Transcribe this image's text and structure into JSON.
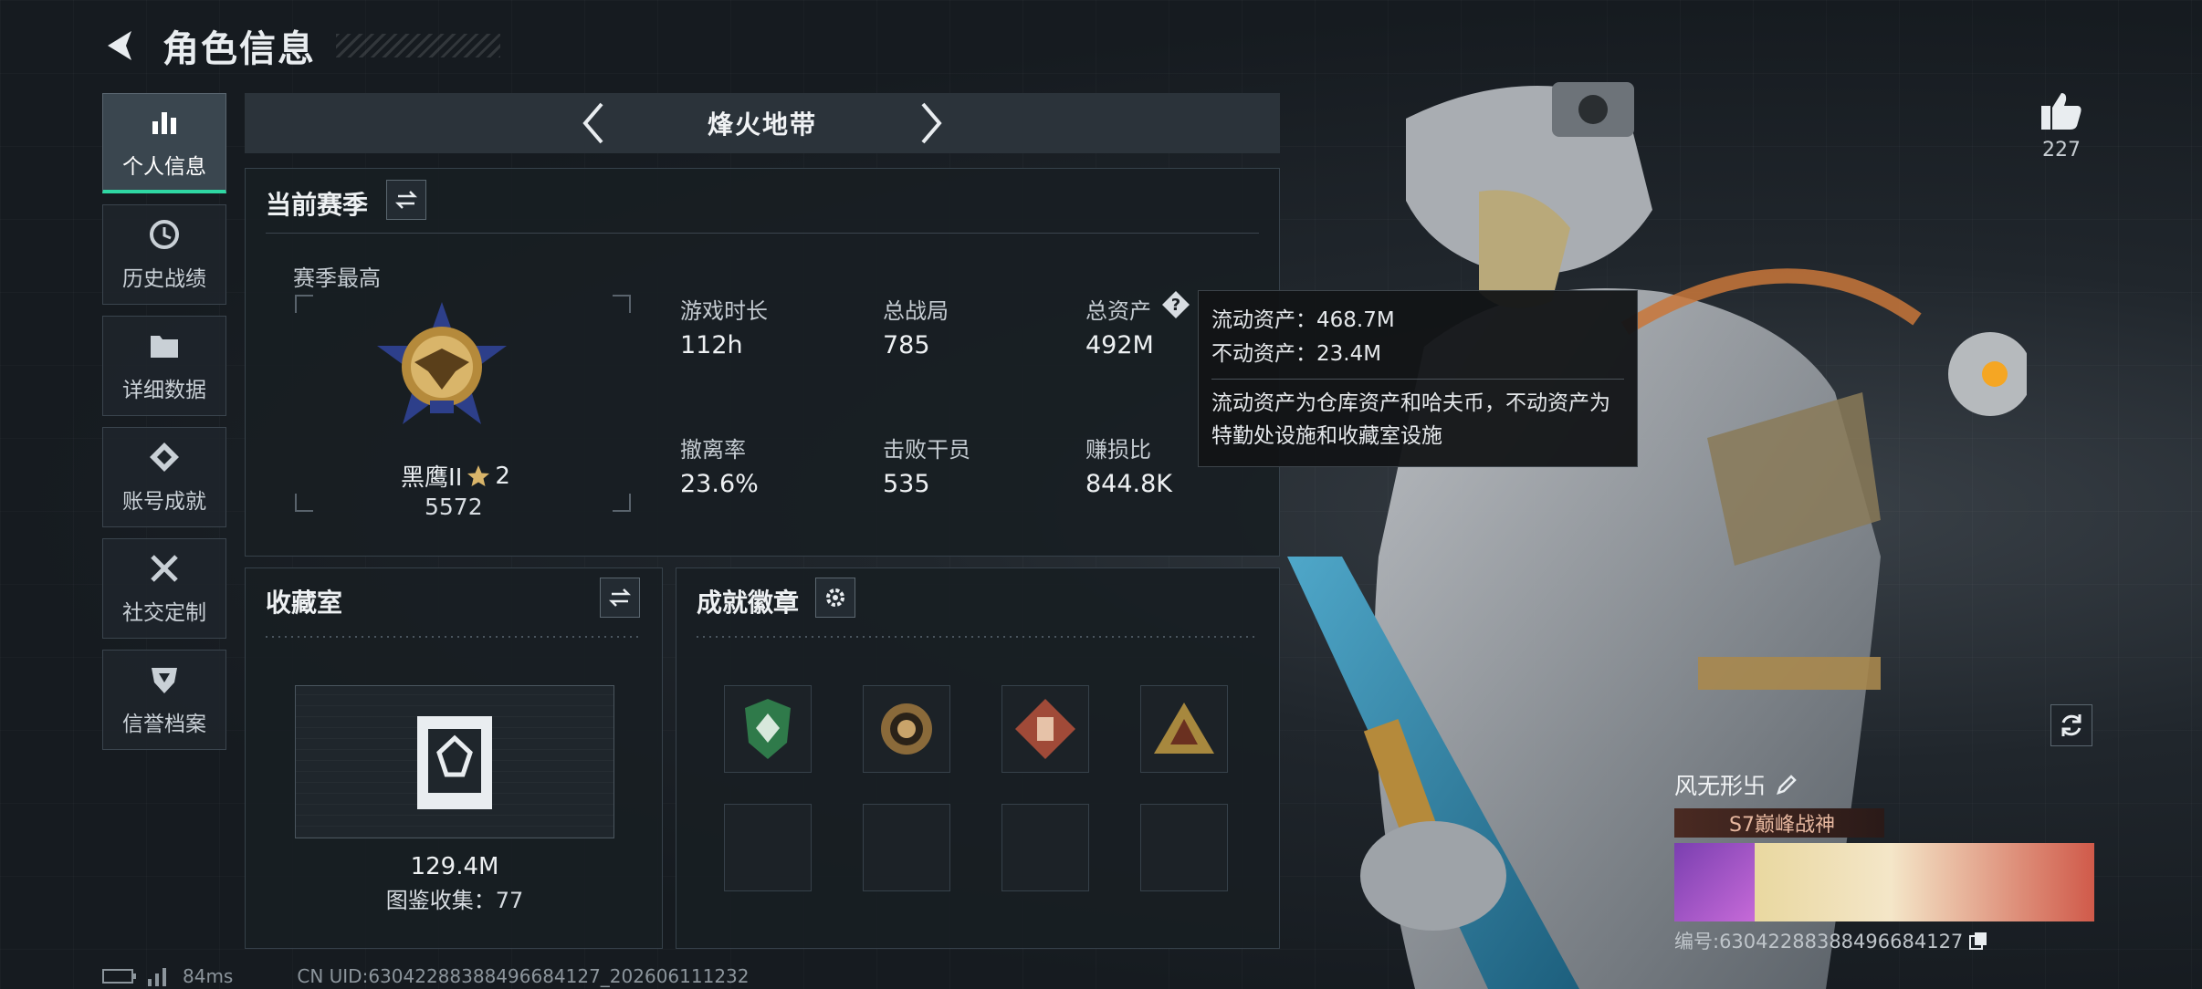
{
  "header": {
    "title": "角色信息"
  },
  "nav": {
    "items": [
      {
        "label": "个人信息",
        "icon": "bar-chart-icon",
        "active": true
      },
      {
        "label": "历史战绩",
        "icon": "history-icon",
        "active": false
      },
      {
        "label": "详细数据",
        "icon": "folder-icon",
        "active": false
      },
      {
        "label": "账号成就",
        "icon": "achievement-icon",
        "active": false
      },
      {
        "label": "社交定制",
        "icon": "tools-icon",
        "active": false
      },
      {
        "label": "信誉档案",
        "icon": "reputation-icon",
        "active": false
      }
    ]
  },
  "mode": {
    "label": "烽火地带"
  },
  "season": {
    "title": "当前赛季",
    "highest_label": "赛季最高",
    "rank_name": "黑鹰II",
    "rank_stars": "2",
    "rank_score": "5572",
    "stats": [
      {
        "label": "游戏时长",
        "value": "112h"
      },
      {
        "label": "总战局",
        "value": "785"
      },
      {
        "label": "总资产",
        "value": "492M"
      },
      {
        "label": "撤离率",
        "value": "23.6%"
      },
      {
        "label": "击败干员",
        "value": "535"
      },
      {
        "label": "赚损比",
        "value": "844.8K"
      }
    ]
  },
  "tooltip": {
    "liquid": "流动资产：468.7M",
    "fixed": "不动资产：23.4M",
    "desc": "流动资产为仓库资产和哈夫币，不动资产为特勤处设施和收藏室设施"
  },
  "collection": {
    "title": "收藏室",
    "value": "129.4M",
    "catalog": "图鉴收集：77"
  },
  "achievements": {
    "title": "成就徽章",
    "badges": [
      "green-shield-badge",
      "gold-ring-badge",
      "red-diamond-badge",
      "gold-triangle-badge"
    ]
  },
  "likes": {
    "count": "227"
  },
  "player": {
    "name": "风无形卐",
    "title_tag": "S7巅峰战神",
    "id_text": "编号:630422883884966841​27"
  },
  "footer": {
    "ping": "84ms",
    "uid": "CN UID:630422883884966841​27_202606111232"
  },
  "colors": {
    "accent": "#2fd7a3",
    "panel": "#181e23"
  }
}
